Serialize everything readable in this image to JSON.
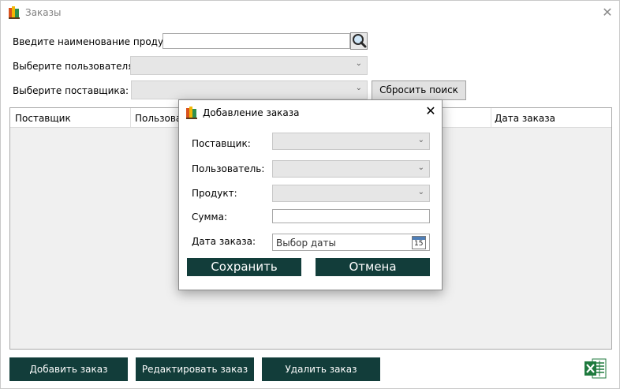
{
  "window": {
    "title": "Заказы"
  },
  "filters": {
    "product_label": "Введите наименование продукта:",
    "product_value": "",
    "user_label": "Выберите пользователя:",
    "user_value": "",
    "supplier_label": "Выберите поставщика:",
    "supplier_value": "",
    "reset_label": "Сбросить поиск"
  },
  "grid": {
    "columns": [
      "Поставщик",
      "Пользоват",
      "Дата заказа"
    ]
  },
  "actions": {
    "add": "Добавить заказ",
    "edit": "Редактировать заказ",
    "delete": "Удалить заказ"
  },
  "dialog": {
    "title": "Добавление заказа",
    "supplier_label": "Поставщик:",
    "user_label": "Пользователь:",
    "product_label": "Продукт:",
    "sum_label": "Сумма:",
    "date_label": "Дата заказа:",
    "date_placeholder": "Выбор даты",
    "calendar_day": "15",
    "save": "Сохранить",
    "cancel": "Отмена"
  },
  "icons": {
    "app": "books-icon",
    "search": "magnifier-icon",
    "calendar": "calendar-icon",
    "excel": "excel-icon",
    "close": "close-icon"
  },
  "colors": {
    "accent": "#123d3a",
    "excel_green": "#1f7a3e"
  }
}
